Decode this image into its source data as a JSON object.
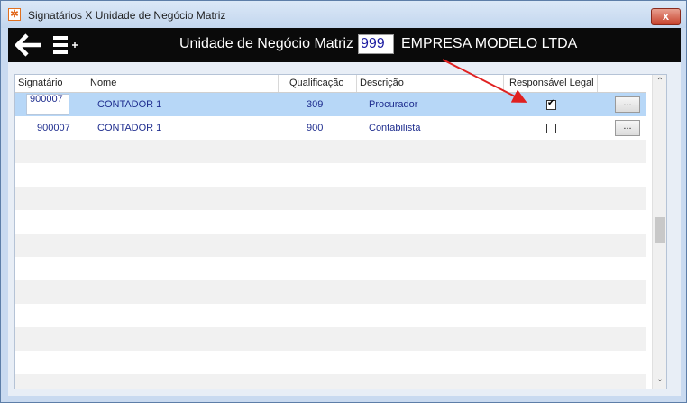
{
  "window": {
    "title": "Signatários X Unidade de Negócio Matriz",
    "close_label": "x"
  },
  "toolbar": {
    "label": "Unidade de Negócio Matriz",
    "code_value": "999",
    "company_name": "EMPRESA MODELO LTDA"
  },
  "grid": {
    "columns": [
      "Signatário",
      "Nome",
      "Qualificação",
      "Descrição",
      "Responsável Legal"
    ],
    "rows": [
      {
        "signatario": "900007",
        "nome": "CONTADOR 1",
        "qualificacao": "309",
        "descricao": "Procurador",
        "responsavel_legal": true,
        "button_label": "..."
      },
      {
        "signatario": "900007",
        "nome": "CONTADOR 1",
        "qualificacao": "900",
        "descricao": "Contabilista",
        "responsavel_legal": false,
        "button_label": "..."
      }
    ]
  },
  "colors": {
    "annotation_arrow": "#e02020",
    "selected_row": "#b7d7f7",
    "toolbar_bg": "#0a0a0a"
  }
}
